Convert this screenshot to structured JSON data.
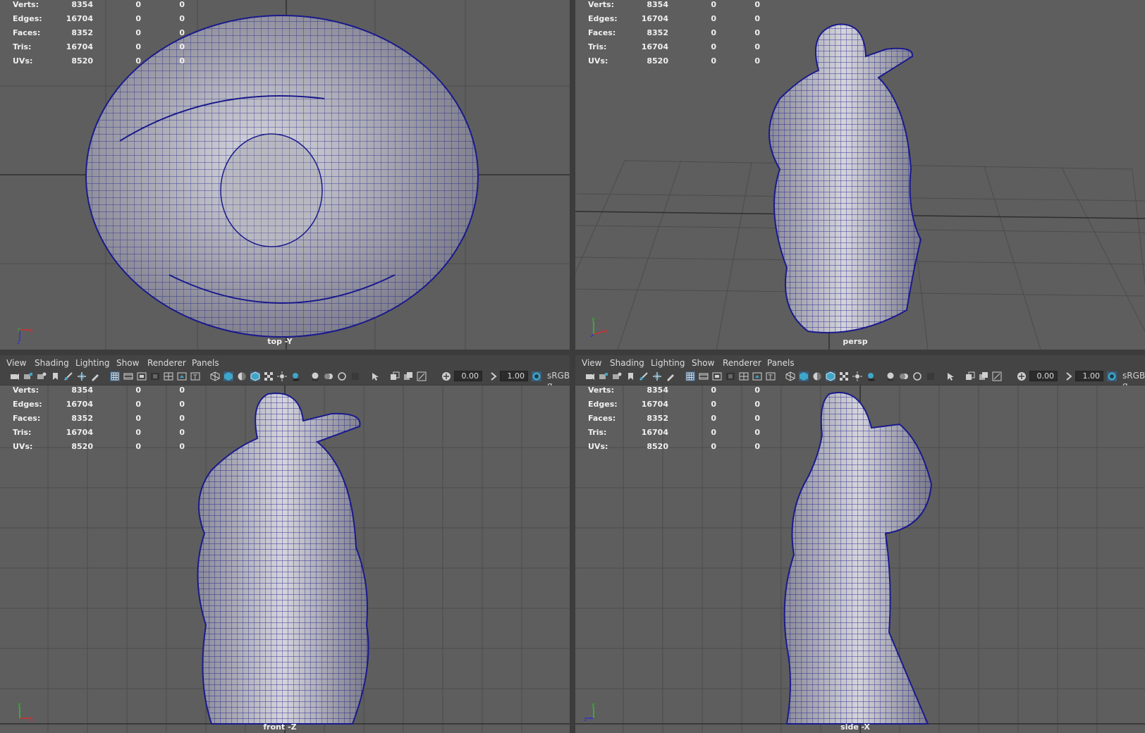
{
  "menus": [
    "View",
    "Shading",
    "Lighting",
    "Show",
    "Renderer",
    "Panels"
  ],
  "toolbar": {
    "exposure": "0.00",
    "gamma": "1.00",
    "colorspace": "sRGB g"
  },
  "hud_labels": [
    "Verts:",
    "Edges:",
    "Faces:",
    "Tris:",
    "UVs:"
  ],
  "hud_values": [
    [
      "8354",
      "0",
      "0"
    ],
    [
      "16704",
      "0",
      "0"
    ],
    [
      "8352",
      "0",
      "0"
    ],
    [
      "16704",
      "0",
      "0"
    ],
    [
      "8520",
      "0",
      "0"
    ]
  ],
  "viewports": {
    "top": {
      "camera": "top -Y"
    },
    "persp": {
      "camera": "persp"
    },
    "front": {
      "camera": "front -Z"
    },
    "side": {
      "camera": "side -X"
    }
  },
  "colors": {
    "viewport_bg": "#5e5e5e",
    "grid_line": "#4a4a4a",
    "grid_axis": "#333333",
    "wire": "#1a1a8c",
    "mesh_fill": "#a8a8b4",
    "toolbar_bg": "#444444",
    "active_icon": "#3fa6c8"
  }
}
